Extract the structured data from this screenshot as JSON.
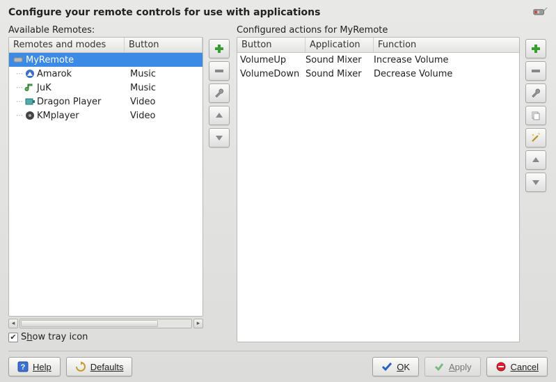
{
  "title": "Configure your remote controls for use with applications",
  "left": {
    "section_label": "Available Remotes:",
    "headers": {
      "c1": "Remotes and modes",
      "c2": "Button"
    },
    "rows": [
      {
        "name": "MyRemote",
        "button": "",
        "icon": "remote",
        "level": 0,
        "selected": true
      },
      {
        "name": "Amarok",
        "button": "Music",
        "icon": "amarok",
        "level": 1,
        "selected": false
      },
      {
        "name": "JuK",
        "button": "Music",
        "icon": "juk",
        "level": 1,
        "selected": false
      },
      {
        "name": "Dragon Player",
        "button": "Video",
        "icon": "dragon",
        "level": 1,
        "selected": false
      },
      {
        "name": "KMplayer",
        "button": "Video",
        "icon": "kmplayer",
        "level": 1,
        "selected": false
      }
    ]
  },
  "right": {
    "section_label": "Configured actions for MyRemote",
    "headers": {
      "c1": "Button",
      "c2": "Application",
      "c3": "Function"
    },
    "rows": [
      {
        "button": "VolumeUp",
        "application": "Sound Mixer",
        "function": "Increase Volume"
      },
      {
        "button": "VolumeDown",
        "application": "Sound Mixer",
        "function": "Decrease Volume"
      }
    ]
  },
  "left_buttons": [
    "add",
    "remove",
    "wrench",
    "up",
    "down"
  ],
  "right_buttons": [
    "add",
    "remove",
    "wrench",
    "copy",
    "autowand",
    "up",
    "down"
  ],
  "checkbox": {
    "label_pre": "S",
    "label_u": "h",
    "label_post": "ow tray icon",
    "checked": true
  },
  "footer": {
    "help": "Help",
    "defaults": "Defaults",
    "ok_u": "O",
    "ok_post": "K",
    "apply_u": "A",
    "apply_post": "pply",
    "cancel": "Cancel"
  }
}
